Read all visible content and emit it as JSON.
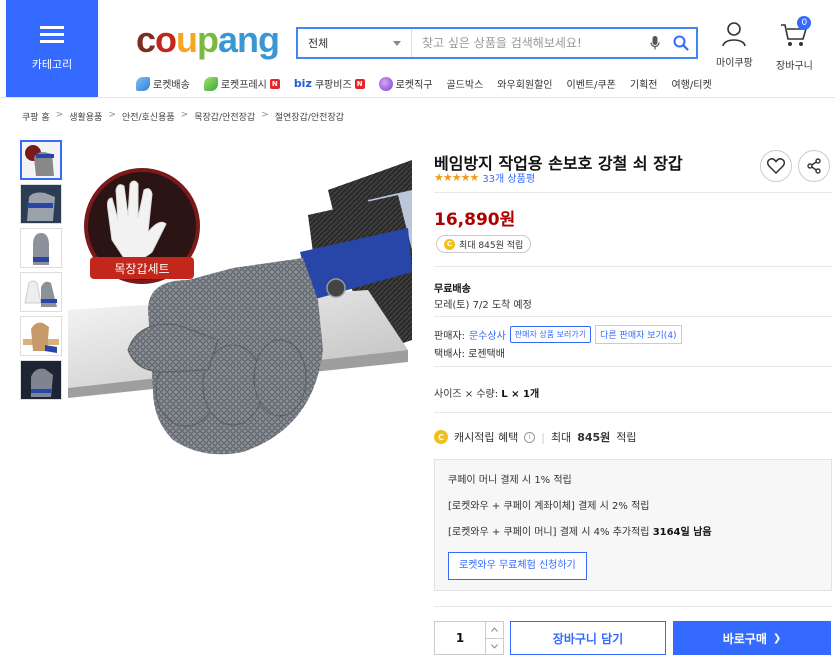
{
  "header": {
    "category_label": "카테고리",
    "logo": {
      "c": "c",
      "o": "o",
      "u": "u",
      "p": "p",
      "ang": "ang"
    },
    "search": {
      "category": "전체",
      "placeholder": "찾고 싶은 상품을 검색해보세요!"
    },
    "mypage_label": "마이쿠팡",
    "cart_label": "장바구니",
    "cart_count": "0",
    "gnb": [
      {
        "label": "로켓배송"
      },
      {
        "label": "로켓프레시",
        "badge": "N"
      },
      {
        "prefix": "biz",
        "label": "쿠팡비즈",
        "badge": "N"
      },
      {
        "label": "로켓직구"
      },
      {
        "label": "골드박스"
      },
      {
        "label": "와우회원할인"
      },
      {
        "label": "이벤트/쿠폰"
      },
      {
        "label": "기획전"
      },
      {
        "label": "여행/티켓"
      }
    ]
  },
  "breadcrumb": [
    "쿠팡 홈",
    "생활용품",
    "안전/호신용품",
    "목장갑/안전장갑",
    "절연장갑/안전장갑"
  ],
  "breadcrumb_sep": ">",
  "gallery": {
    "image_badge_text": "목장갑세트"
  },
  "product": {
    "title": "베임방지 작업용 손보호 강철 쇠 장갑",
    "stars": "★★★★★",
    "rating": 4.5,
    "review_count_text": "33개 상품평",
    "price": "16,890원",
    "reward_text": "최대 845원 적립",
    "shipping_title": "무료배송",
    "delivery_text": "모레(토) 7/2 도착 예정",
    "seller_label": "판매자:",
    "seller_name": "문수상사",
    "seller_products_btn": "판매자 상품 보러가기",
    "other_sellers_btn": "다른 판매자 보기(4)",
    "courier_text": "택배사: 로젠택배",
    "option_label": "사이즈 × 수량:",
    "option_value": "L × 1개",
    "cash_label": "캐시적립 혜택",
    "cash_sep": "|",
    "cash_max_prefix": "최대",
    "cash_max_value": "845원",
    "cash_max_suffix": "적립",
    "coin_letter": "C",
    "info_icon_glyph": "i"
  },
  "benefits": {
    "line1": "쿠페이 머니 결제 시 1% 적립",
    "line2": "[로켓와우 + 쿠페이 계좌이체] 결제 시 2% 적립",
    "line3_text": "[로켓와우 + 쿠페이 머니] 결제 시 4% 추가적립",
    "line3_bold": "3164일 남음",
    "trial_btn": "로켓와우 무료체험 신청하기"
  },
  "purchase": {
    "quantity": "1",
    "cart_btn": "장바구니 담기",
    "buy_btn": "바로구매",
    "buy_arrow": "❯"
  },
  "colors": {
    "accent": "#346aff",
    "price": "#ae0000",
    "star": "#f59a11"
  }
}
